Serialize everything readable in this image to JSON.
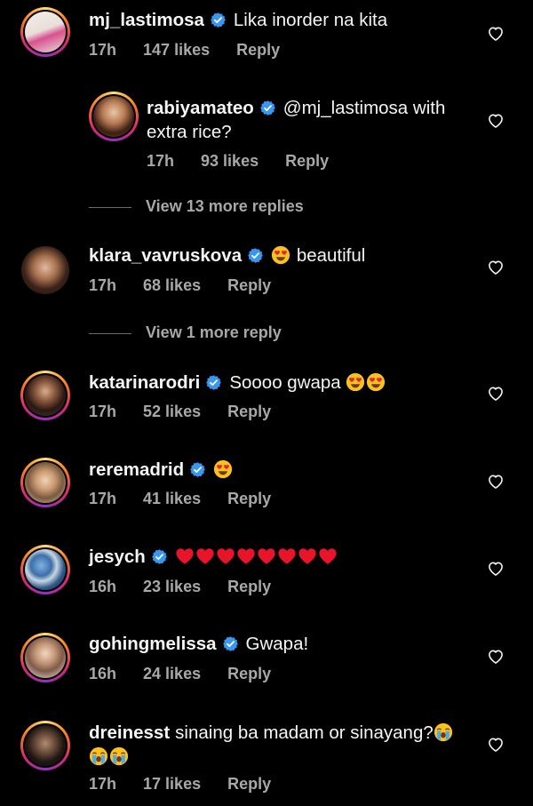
{
  "comments": [
    {
      "username": "mj_lastimosa",
      "text": "Lika inorder na kita",
      "time": "17h",
      "likes": "147 likes",
      "reply": "Reply"
    },
    {
      "username": "rabiyamateo",
      "text_line1": "@mj_lastimosa with",
      "text_line2": "extra rice?",
      "time": "17h",
      "likes": "93 likes",
      "reply": "Reply"
    },
    {
      "username": "klara_vavruskova",
      "text": "beautiful",
      "time": "17h",
      "likes": "68 likes",
      "reply": "Reply"
    },
    {
      "username": "katarinarodri",
      "text": "Soooo gwapa",
      "time": "17h",
      "likes": "52 likes",
      "reply": "Reply"
    },
    {
      "username": "reremadrid",
      "text": "",
      "time": "17h",
      "likes": "41 likes",
      "reply": "Reply"
    },
    {
      "username": "jesych",
      "text": "",
      "time": "16h",
      "likes": "23 likes",
      "reply": "Reply"
    },
    {
      "username": "gohingmelissa",
      "text": "Gwapa!",
      "time": "16h",
      "likes": "24 likes",
      "reply": "Reply"
    },
    {
      "username": "dreinesst",
      "text": "sinaing ba madam or sinayang?",
      "time": "17h",
      "likes": "17 likes",
      "reply": "Reply"
    }
  ],
  "view_more": {
    "first": "View 13 more replies",
    "second": "View 1 more reply"
  },
  "colors": {
    "background": "#000000",
    "text": "#f5f5f5",
    "meta": "#a8a8a8",
    "verified": "#3897f0",
    "heart_emoji": "#e8142a"
  },
  "icons": {
    "verified": "verified-badge-icon",
    "like": "heart-outline-icon",
    "emoji_heart_eyes": "heart-eyes-emoji",
    "emoji_red_heart": "red-heart-emoji",
    "emoji_crying": "loudly-crying-emoji"
  }
}
